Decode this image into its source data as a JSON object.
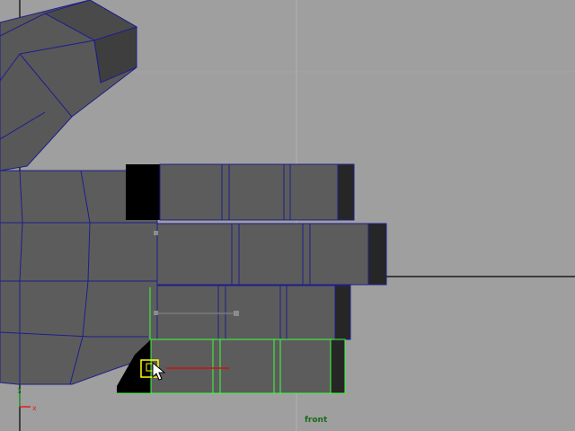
{
  "viewport": {
    "camera_label": "front",
    "background_color": "#9f9f9f",
    "grid_color": "#b4b4b4",
    "mesh_color": "#5a5a5a",
    "wireframe_color": "#1e1e8c",
    "selection_color": "#3cff3c",
    "manipulator_color": "#ffff00"
  },
  "axis_indicator": {
    "x_label": "x",
    "y_label": "y",
    "x_color": "#e02020",
    "y_color": "#20a020"
  },
  "cursor": {
    "icon": "arrow-cursor-icon"
  }
}
